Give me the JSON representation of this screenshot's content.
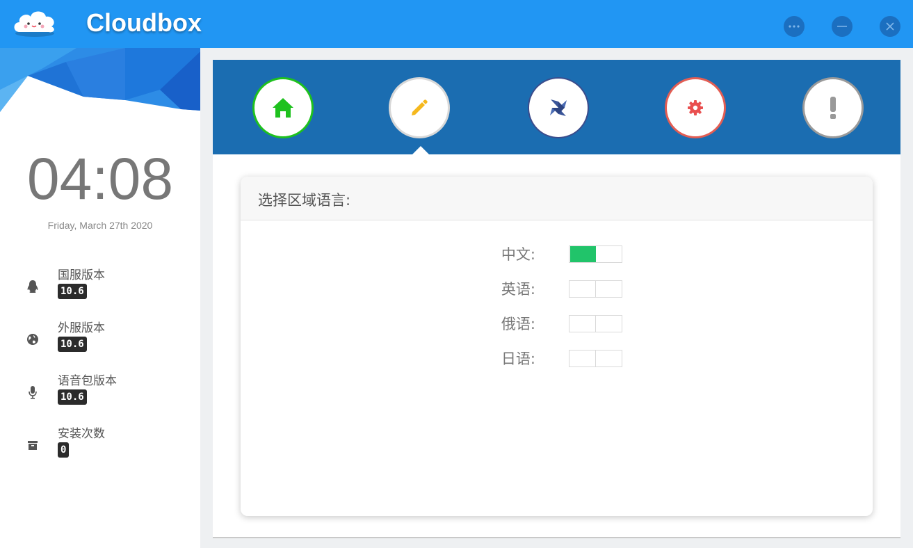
{
  "app": {
    "title": "Cloudbox"
  },
  "window_buttons": {
    "more": "more-icon",
    "minimize": "minimize-icon",
    "close": "close-icon"
  },
  "sidebar": {
    "clock": "04:08",
    "date": "Friday, March 27th 2020",
    "stats": [
      {
        "label": "国服版本",
        "value": "10.6",
        "icon": "qq-penguin-icon"
      },
      {
        "label": "外服版本",
        "value": "10.6",
        "icon": "globe-icon"
      },
      {
        "label": "语音包版本",
        "value": "10.6",
        "icon": "microphone-icon"
      },
      {
        "label": "安装次数",
        "value": "0",
        "icon": "archive-box-icon"
      }
    ]
  },
  "nav": {
    "items": [
      {
        "name": "home",
        "icon": "home-icon",
        "ring_color": "#1ec11e",
        "icon_color": "#1ec11e"
      },
      {
        "name": "edit",
        "icon": "pencil-icon",
        "ring_color": "#d8d8d8",
        "icon_color": "#f5b81d",
        "active": true
      },
      {
        "name": "windmill",
        "icon": "pinwheel-icon",
        "ring_color": "#3b4c8c",
        "icon_color": "#3a5599"
      },
      {
        "name": "settings",
        "icon": "gear-icon",
        "ring_color": "#e35d53",
        "icon_color": "#e94f4f"
      },
      {
        "name": "about",
        "icon": "exclamation-icon",
        "ring_color": "#9a9a9a",
        "icon_color": "#999999"
      }
    ]
  },
  "panel": {
    "title": "选择区域语言:",
    "languages": [
      {
        "label": "中文:",
        "enabled": true
      },
      {
        "label": "英语:",
        "enabled": false
      },
      {
        "label": "俄语:",
        "enabled": false
      },
      {
        "label": "日语:",
        "enabled": false
      }
    ],
    "toggle_on_color": "#21c46a"
  },
  "colors": {
    "titlebar": "#2196f3",
    "navbar": "#1b6db1"
  }
}
